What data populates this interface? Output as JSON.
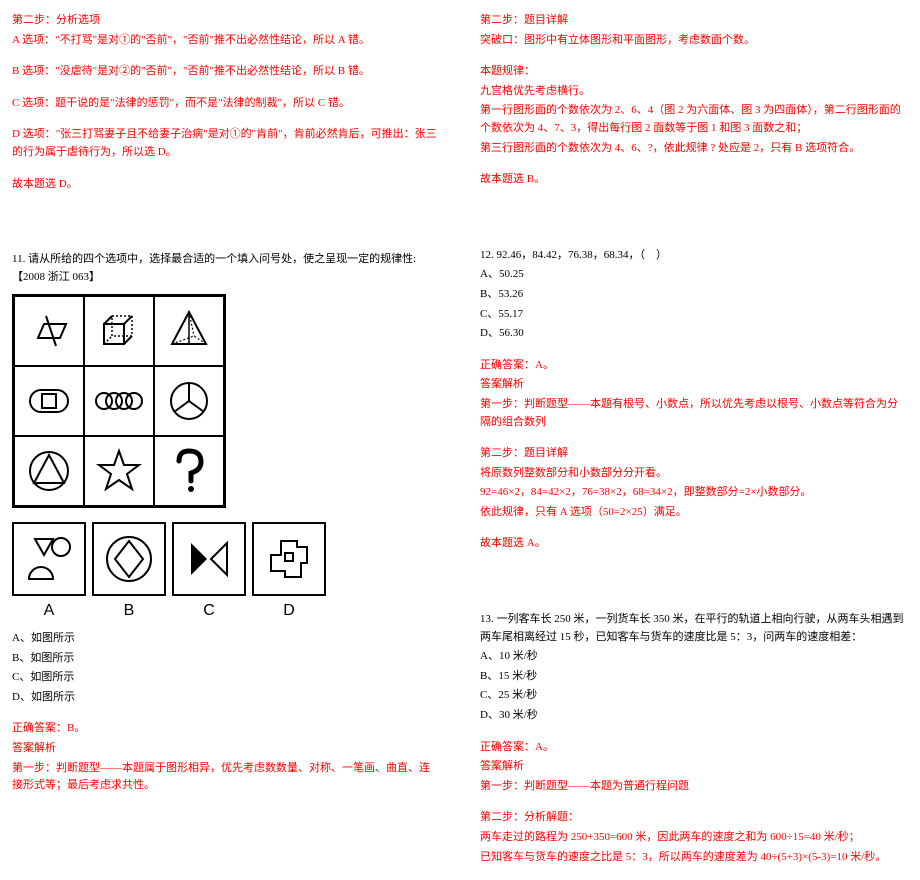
{
  "left": {
    "step2_title": "第二步：分析选项",
    "optA": "A 选项：\"不打骂\"是对①的\"否前\"，\"否前\"推不出必然性结论，所以 A 错。",
    "optB": "B 选项：\"没虐待\"是对②的\"否前\"，\"否前\"推不出必然性结论，所以 B 错。",
    "optC": "C 选项：题干说的是\"法律的惩罚\"，而不是\"法律的制裁\"，所以 C 错。",
    "optD": "D 选项：\"张三打骂妻子且不给妻子治病\"是对①的\"肯前\"，肯前必然肯后，可推出：张三的行为属于虐待行为，所以选 D。",
    "final": "故本题选 D。",
    "q11": "11. 请从所给的四个选项中，选择最合适的一个填入问号处，使之呈现一定的规律性:【2008 浙江 063】",
    "choices": [
      "A、如图所示",
      "B、如图所示",
      "C、如图所示",
      "D、如图所示"
    ],
    "ans": "正确答案：B。",
    "ans_explain_label": "答案解析",
    "step1": "第一步：判断题型——本题属于图形相异，优先考虑数数量、对称、一笔画、曲直、连接形式等；最后考虑求共性。"
  },
  "right": {
    "step2_title": "第二步：题目详解",
    "breakthrough": "突破口：图形中有立体图形和平面图形，考虑数面个数。",
    "pattern_title": "本题规律：",
    "pattern1": "九宫格优先考虑横行。",
    "pattern2": "第一行图形面的个数依次为 2、6、4（图 2 为六面体、图 3 为四面体），第二行图形面的个数依次为 4、7、3，得出每行图 2 面数等于图 1 和图 3 面数之和；",
    "pattern3": "第三行图形面的个数依次为 4、6、?，依此规律 ? 处应是 2，只有 B 选项符合。",
    "final11": "故本题选 B。",
    "q12": "12. 92.46，84.42，76.38，68.34，（　）",
    "q12opts": [
      "A、50.25",
      "B、53.26",
      "C、55.17",
      "D、56.30"
    ],
    "q12ans": "正确答案：A。",
    "q12explain_label": "答案解析",
    "q12step1": "第一步：判断题型——本题有根号、小数点，所以优先考虑以根号、小数点等符合为分隔的组合数列",
    "q12step2_title": "第二步：题目详解",
    "q12step2a": "将原数列整数部分和小数部分分开看。",
    "q12step2b": "92=46×2，84=42×2，76=38×2，68=34×2，即整数部分=2×小数部分。",
    "q12step2c": "依此规律，只有 A 选项（50=2×25）满足。",
    "q12final": "故本题选 A。",
    "q13": "13. 一列客车长 250 米，一列货车长 350 米，在平行的轨道上相向行驶，从两车头相遇到两车尾相离经过 15 秒，已知客车与货车的速度比是 5：3，问两车的速度相差：",
    "q13opts": [
      "A、10 米/秒",
      "B、15 米/秒",
      "C、25 米/秒",
      "D、30 米/秒"
    ],
    "q13ans": "正确答案：A。",
    "q13explain_label": "答案解析",
    "q13step1": "第一步：判断题型——本题为普通行程问题",
    "q13step2_title": "第二步：分析解题：",
    "q13step2a": "两车走过的路程为 250+350=600 米，因此两车的速度之和为 600÷15=40 米/秒；",
    "q13step2b": "已知客车与货车的速度之比是 5：3，所以两车的速度差为 40÷(5+3)×(5-3)=10 米/秒。"
  },
  "opt_labels": [
    "A",
    "B",
    "C",
    "D"
  ]
}
